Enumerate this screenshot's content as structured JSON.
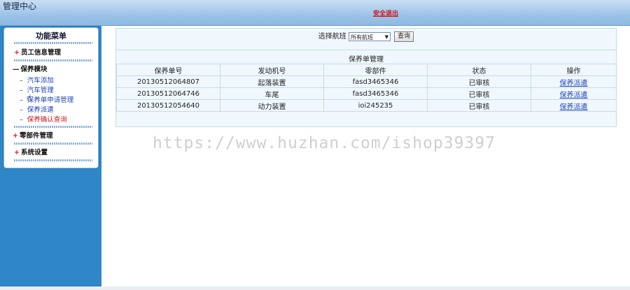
{
  "header": {
    "title": "管理中心",
    "logout_label": "安全退出"
  },
  "sidebar": {
    "title": "功能菜单",
    "groups": [
      {
        "label": "员工信息管理",
        "mark": "+"
      },
      {
        "label": "保养模块",
        "mark": "—",
        "items": [
          "汽车添加",
          "汽车管理",
          "保养单申请管理",
          "保养派遣",
          "保养确认查询"
        ]
      },
      {
        "label": "零部件管理",
        "mark": "+"
      },
      {
        "label": "系统设置",
        "mark": "+"
      }
    ],
    "active_item": "保养确认查询"
  },
  "filter": {
    "label": "选择航班",
    "selected": "所有航班",
    "button": "查询"
  },
  "table": {
    "caption": "保养单管理",
    "columns": [
      "保养单号",
      "发动机号",
      "零部件",
      "状态",
      "操作"
    ],
    "rows": [
      {
        "id": "20130512064807",
        "engine": "起落装置",
        "part": "fasd3465346",
        "status": "已审核",
        "action": "保养派遣"
      },
      {
        "id": "20130512064746",
        "engine": "车尾",
        "part": "fasd3465346",
        "status": "已审核",
        "action": "保养派遣"
      },
      {
        "id": "20130512054640",
        "engine": "动力装置",
        "part": "ioi245235",
        "status": "已审核",
        "action": "保养派遣"
      }
    ]
  },
  "watermark": "https://www.huzhan.com/ishop39397",
  "colors": {
    "sidebar": "#2f87c8",
    "link": "#1f45b8",
    "active": "#d0191b"
  }
}
